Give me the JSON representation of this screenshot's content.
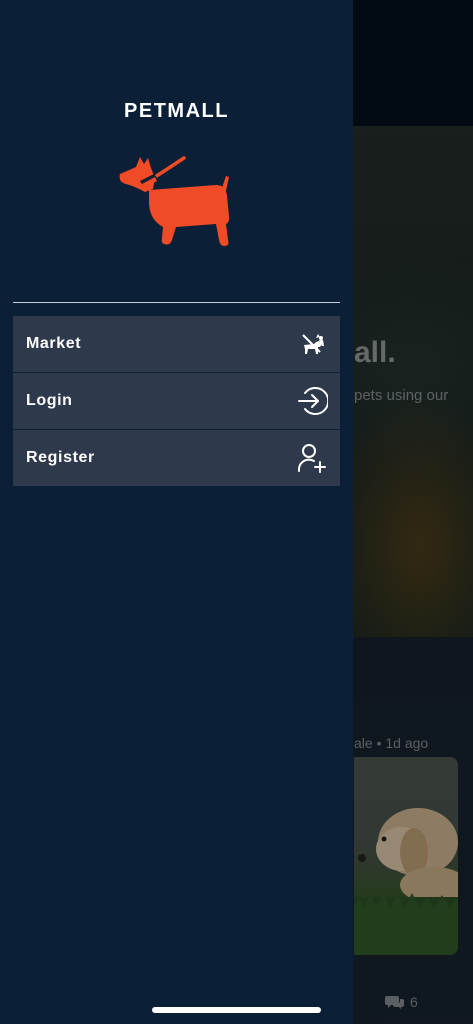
{
  "background": {
    "hero_title": "all.",
    "hero_subtitle": "pets using our",
    "card_meta": "ale • 1d ago",
    "comment_count": "6"
  },
  "drawer": {
    "brand": "PETMALL",
    "logo_icon": "dog-icon",
    "menu": [
      {
        "label": "Market",
        "icon": "dog-walking-icon"
      },
      {
        "label": "Login",
        "icon": "login-arrow-icon"
      },
      {
        "label": "Register",
        "icon": "add-user-icon"
      }
    ]
  },
  "colors": {
    "drawer_bg": "#0b2036",
    "menu_item_bg": "#2e3a4c",
    "logo": "#f04a26",
    "text": "#ffffff"
  }
}
